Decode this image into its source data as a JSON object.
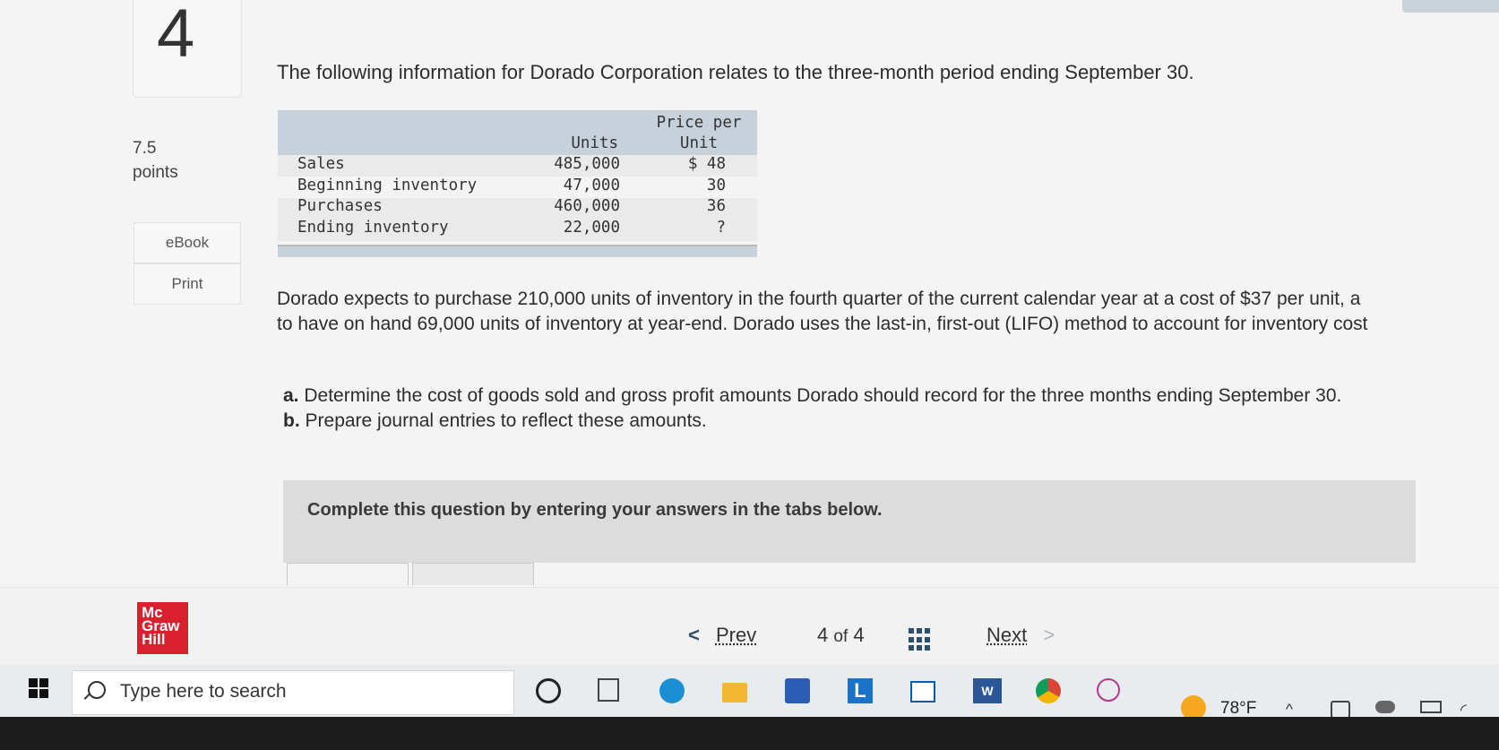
{
  "question": {
    "number": "4",
    "points_value": "7.5",
    "points_label": "points",
    "ebook_label": "eBook",
    "print_label": "Print",
    "intro": "The following information for Dorado Corporation relates to the three-month period ending September 30.",
    "paragraph_line1": "Dorado expects to purchase 210,000 units of inventory in the fourth quarter of the current calendar year at a cost of $37 per unit, a",
    "paragraph_line2": "to have on hand 69,000 units of inventory at year-end. Dorado uses the last-in, first-out (LIFO) method to account for inventory cost",
    "req_a_label": "a.",
    "req_a_text": "Determine the cost of goods sold and gross profit amounts Dorado should record for the three months ending September 30.",
    "req_b_label": "b.",
    "req_b_text": "Prepare journal entries to reflect these amounts.",
    "banner": "Complete this question by entering your answers in the tabs below."
  },
  "table": {
    "col_units": "Units",
    "col_price_line1": "Price per",
    "col_price_line2": "Unit",
    "rows": [
      {
        "label": "Sales",
        "units": "485,000",
        "price": "$ 48"
      },
      {
        "label": "Beginning inventory",
        "units": "47,000",
        "price": "30"
      },
      {
        "label": "Purchases",
        "units": "460,000",
        "price": "36"
      },
      {
        "label": "Ending inventory",
        "units": "22,000",
        "price": "?"
      }
    ]
  },
  "footer": {
    "logo_line1": "Mc",
    "logo_line2": "Graw",
    "logo_line3": "Hill",
    "prev_label": "Prev",
    "page_current": "4",
    "page_of": "of",
    "page_total": "4",
    "next_label": "Next"
  },
  "taskbar": {
    "search_placeholder": "Type here to search",
    "temperature": "78°F"
  }
}
